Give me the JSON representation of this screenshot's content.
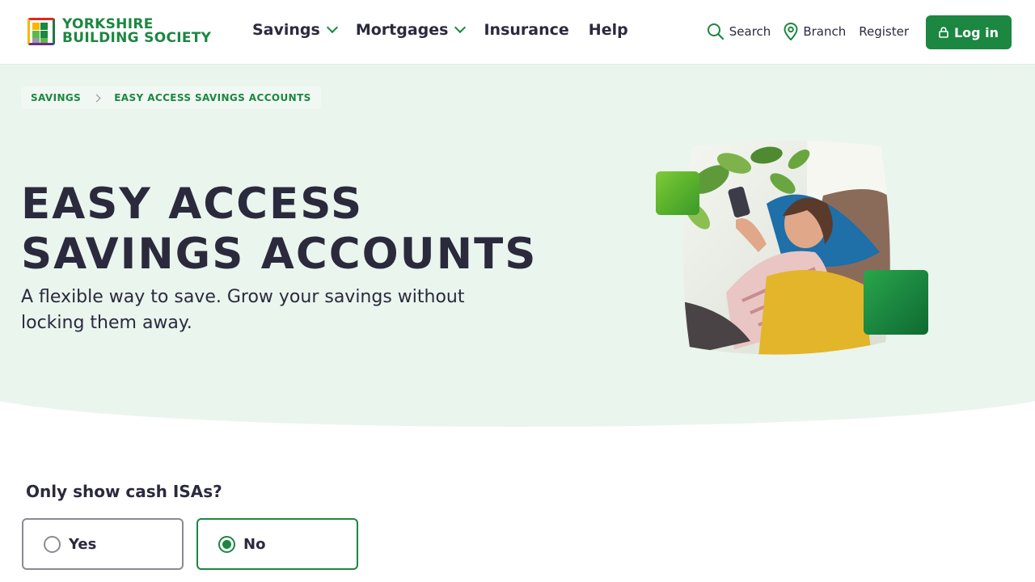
{
  "brand": {
    "name_line1": "YORKSHIRE",
    "name_line2": "BUILDING SOCIETY",
    "logo_icon": "checkered-square-logo"
  },
  "nav": {
    "items": [
      {
        "label": "Savings",
        "has_dropdown": true
      },
      {
        "label": "Mortgages",
        "has_dropdown": true
      },
      {
        "label": "Insurance",
        "has_dropdown": false
      },
      {
        "label": "Help",
        "has_dropdown": false
      }
    ]
  },
  "utility": {
    "search_label": "Search",
    "search_icon": "search-icon",
    "branch_label": "Branch",
    "branch_icon": "map-pin-icon",
    "register_label": "Register",
    "login_label": "Log in",
    "login_icon": "lock-icon"
  },
  "breadcrumb": {
    "items": [
      "SAVINGS",
      "EASY ACCESS SAVINGS ACCOUNTS"
    ]
  },
  "hero": {
    "title_line1": "EASY ACCESS",
    "title_line2": "SAVINGS ACCOUNTS",
    "subtitle": "A flexible way to save. Grow your savings without locking them away."
  },
  "filter": {
    "question": "Only show cash ISAs?",
    "options": [
      {
        "label": "Yes",
        "selected": false
      },
      {
        "label": "No",
        "selected": true
      }
    ]
  },
  "colors": {
    "brand_green": "#1b8740",
    "hero_bg": "#eaf5ee",
    "text_dark": "#2b2a3d"
  }
}
